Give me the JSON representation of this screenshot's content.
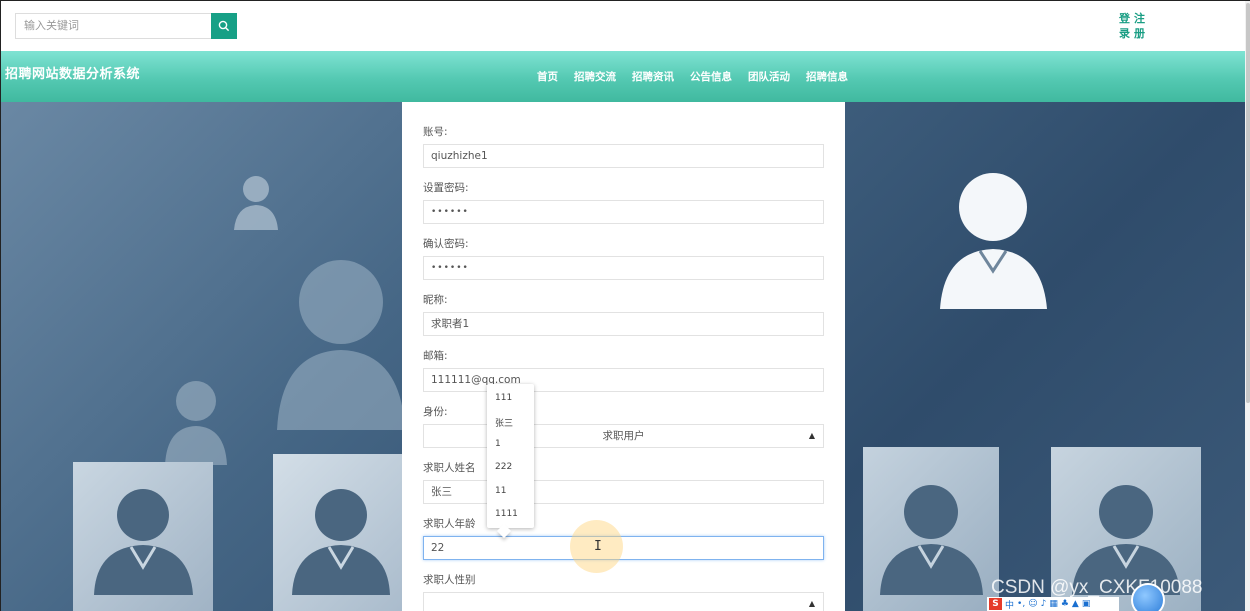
{
  "search": {
    "placeholder": "输入关键词",
    "icon": "search-icon"
  },
  "auth": {
    "login_1": "登",
    "login_2": "录",
    "register_1": "注",
    "register_2": "册"
  },
  "site": {
    "title": "招聘网站数据分析系统"
  },
  "nav": {
    "items": [
      {
        "label": "首页"
      },
      {
        "label": "招聘交流"
      },
      {
        "label": "招聘资讯"
      },
      {
        "label": "公告信息"
      },
      {
        "label": "团队活动"
      },
      {
        "label": "招聘信息"
      }
    ]
  },
  "form": {
    "account": {
      "label": "账号:",
      "value": "qiuzhizhe1"
    },
    "password": {
      "label": "设置密码:",
      "value": "••••••"
    },
    "confirm": {
      "label": "确认密码:",
      "value": "••••••"
    },
    "nickname": {
      "label": "昵称:",
      "value": "求职者1"
    },
    "email": {
      "label": "邮箱:",
      "value": "111111@qq.com"
    },
    "role": {
      "label": "身份:",
      "value": "求职用户"
    },
    "name": {
      "label": "求职人姓名",
      "value": "张三"
    },
    "age": {
      "label": "求职人年龄",
      "value": "22"
    },
    "gender": {
      "label": "求职人性别",
      "value": ""
    }
  },
  "autocomplete": {
    "options": [
      "111",
      "张三",
      "1",
      "222",
      "11",
      "1111"
    ]
  },
  "watermark": "CSDN @yx_CXKF10088",
  "ime": {
    "label": "中"
  },
  "colors": {
    "accent": "#17a086",
    "nav_top": "#7fe3d3",
    "nav_bottom": "#40b99f"
  }
}
